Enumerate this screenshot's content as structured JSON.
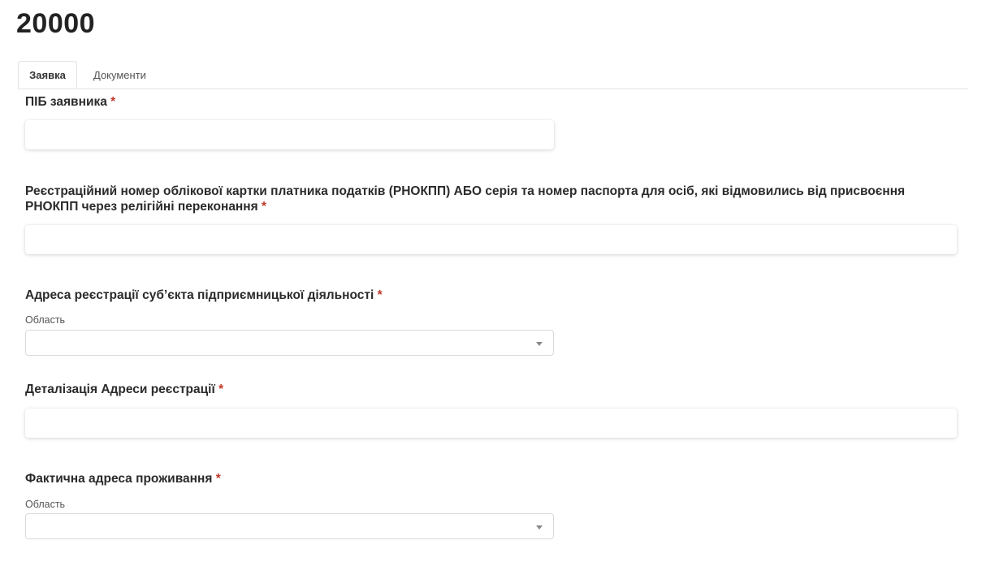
{
  "page": {
    "title": "20000"
  },
  "tabs": [
    {
      "label": "Заявка",
      "active": true
    },
    {
      "label": "Документи",
      "active": false
    }
  ],
  "required_mark": "*",
  "form": {
    "applicant_name": {
      "label": "ПІБ заявника",
      "value": ""
    },
    "tax_number": {
      "label_line1": "Реєстраційний номер облікової картки платника податків (РНОКПП) АБО серія та номер паспорта для осіб, які відмовились від присвоєння",
      "label_line2": "РНОКПП через релігійні переконання",
      "value": ""
    },
    "registration_address": {
      "label": "Адреса реєстрації суб’єкта підприємницької діяльності",
      "region_label": "Область",
      "region_value": ""
    },
    "registration_address_details": {
      "label": "Деталізація Адреси реєстрації",
      "value": ""
    },
    "actual_address": {
      "label": "Фактична адреса проживання",
      "region_label": "Область",
      "region_value": ""
    }
  },
  "icons": {
    "dropdown": "caret-down-icon"
  },
  "colors": {
    "required": "#c0392b",
    "tab_border": "#dee2e6",
    "text": "#222222"
  }
}
